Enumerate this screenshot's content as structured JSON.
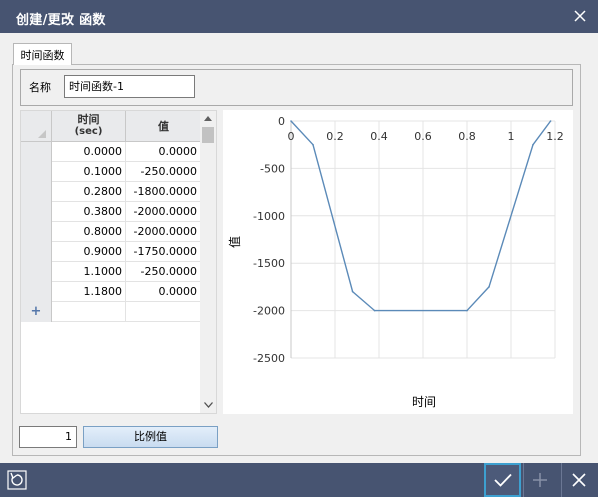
{
  "window": {
    "title": "创建/更改 函数"
  },
  "tab": {
    "label": "时间函数"
  },
  "name_field": {
    "label": "名称",
    "value": "时间函数-1"
  },
  "grid": {
    "header_time": "时间",
    "header_time_unit": "(sec)",
    "header_value": "值",
    "rows": [
      {
        "time": "0.0000",
        "value": "0.0000"
      },
      {
        "time": "0.1000",
        "value": "-250.0000"
      },
      {
        "time": "0.2800",
        "value": "-1800.0000"
      },
      {
        "time": "0.3800",
        "value": "-2000.0000"
      },
      {
        "time": "0.8000",
        "value": "-2000.0000"
      },
      {
        "time": "0.9000",
        "value": "-1750.0000"
      },
      {
        "time": "1.1000",
        "value": "-250.0000"
      },
      {
        "time": "1.1800",
        "value": "0.0000"
      }
    ],
    "new_row_symbol": "+"
  },
  "scale": {
    "value": "1",
    "button_label": "比例值"
  },
  "chart_data": {
    "type": "line",
    "xlabel": "时间",
    "ylabel": "值",
    "xlim": [
      0,
      1.2
    ],
    "ylim": [
      -2500,
      0
    ],
    "x_ticks": [
      "0",
      "0.2",
      "0.4",
      "0.6",
      "0.8",
      "1",
      "1.2"
    ],
    "y_ticks": [
      "0",
      "-500",
      "-1000",
      "-1500",
      "-2000",
      "-2500"
    ],
    "grid": true,
    "series": [
      {
        "x": [
          0,
          0.1,
          0.28,
          0.38,
          0.8,
          0.9,
          1.1,
          1.18
        ],
        "y": [
          0,
          -250,
          -1800,
          -2000,
          -2000,
          -1750,
          -250,
          0
        ],
        "color": "#5b8ab8"
      }
    ]
  },
  "colors": {
    "title_bar": "#475471",
    "accent": "#3da0d0"
  },
  "icons": {
    "close": "close-icon",
    "reset": "reset-icon",
    "ok": "check-icon",
    "add": "plus-icon",
    "cancel": "cancel-icon"
  }
}
